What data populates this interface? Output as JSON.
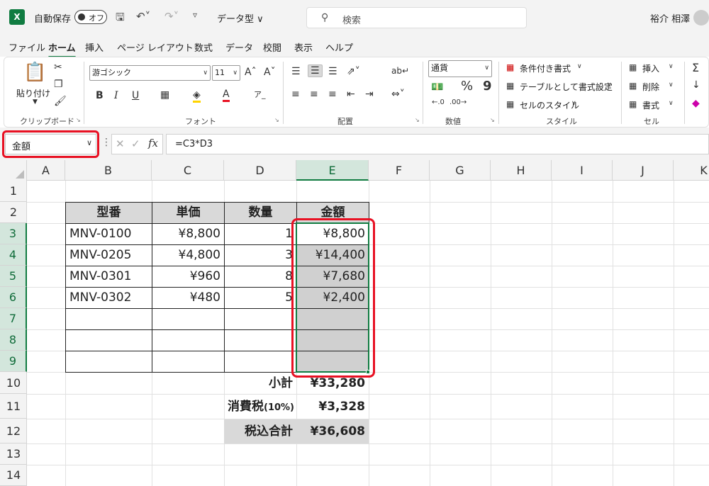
{
  "titlebar": {
    "logo": "X",
    "autosave_label": "自動保存",
    "autosave_state": "オフ",
    "doc_title": "データ型 ∨",
    "search_placeholder": "検索",
    "user_name": "裕介 相澤"
  },
  "tabs": [
    "ファイル",
    "ホーム",
    "挿入",
    "ページ レイアウト",
    "数式",
    "データ",
    "校閲",
    "表示",
    "ヘルプ"
  ],
  "ribbon": {
    "clipboard": {
      "paste_label": "貼り付け",
      "group_label": "クリップボード"
    },
    "font": {
      "font_name": "游ゴシック",
      "font_size": "11",
      "bold": "B",
      "italic": "I",
      "underline": "U",
      "group_label": "フォント"
    },
    "alignment": {
      "group_label": "配置"
    },
    "number": {
      "format": "通貨",
      "percent": "%",
      "comma": "9",
      "group_label": "数値"
    },
    "styles": {
      "conditional": "条件付き書式",
      "table_format": "テーブルとして書式設定",
      "cell_style": "セルのスタイル",
      "group_label": "スタイル"
    },
    "cells": {
      "insert": "挿入",
      "delete": "削除",
      "format": "書式",
      "group_label": "セル"
    },
    "editing": {
      "sum": "Σ"
    }
  },
  "formula_bar": {
    "name_box": "金額",
    "fx": "fx",
    "formula": "=C3*D3"
  },
  "grid": {
    "columns": [
      "A",
      "B",
      "C",
      "D",
      "E",
      "F",
      "G",
      "H",
      "I",
      "J",
      "K"
    ],
    "rows": [
      "1",
      "2",
      "3",
      "4",
      "5",
      "6",
      "7",
      "8",
      "9",
      "10",
      "11",
      "12",
      "13",
      "14"
    ],
    "table_headers": [
      "型番",
      "単価",
      "数量",
      "金額"
    ],
    "table_rows": [
      [
        "MNV-0100",
        "¥8,800",
        "1",
        "¥8,800"
      ],
      [
        "MNV-0205",
        "¥4,800",
        "3",
        "¥14,400"
      ],
      [
        "MNV-0301",
        "¥960",
        "8",
        "¥7,680"
      ],
      [
        "MNV-0302",
        "¥480",
        "5",
        "¥2,400"
      ]
    ],
    "subtotal_label": "小計",
    "subtotal": "¥33,280",
    "tax_label": "消費税",
    "tax_rate": "(10%)",
    "tax": "¥3,328",
    "total_label": "税込合計",
    "total": "¥36,608"
  },
  "colors": {
    "accent": "#107c41",
    "highlight": "#e81123"
  }
}
